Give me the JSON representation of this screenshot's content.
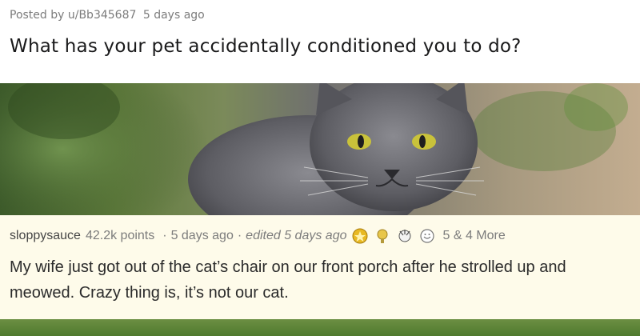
{
  "post": {
    "meta_posted_by": "Posted by u/Bb345687",
    "meta_time": "5 days ago",
    "title": "What has your pet accidentally conditioned you to do?"
  },
  "image": {
    "subject": "grey-cat-photo",
    "colors": {
      "fur": "#6e6e74",
      "eyes": "#c9c23a",
      "foliage": "#4f7a2e",
      "background_warm": "#c3ad90"
    }
  },
  "comment": {
    "username": "sloppysauce",
    "points": "42.2k points",
    "separator": "·",
    "time": "5 days ago",
    "edited": "edited 5 days ago",
    "awards": [
      "gold-award-icon",
      "silver-award-icon",
      "gilded-award-icon",
      "wholesome-award-icon"
    ],
    "award_count": "5 & 4 More",
    "body": "My wife just got out of the cat’s chair on our front porch after he strolled up and meowed. Crazy thing is, it’s not our cat.",
    "background": "#fefbea"
  }
}
